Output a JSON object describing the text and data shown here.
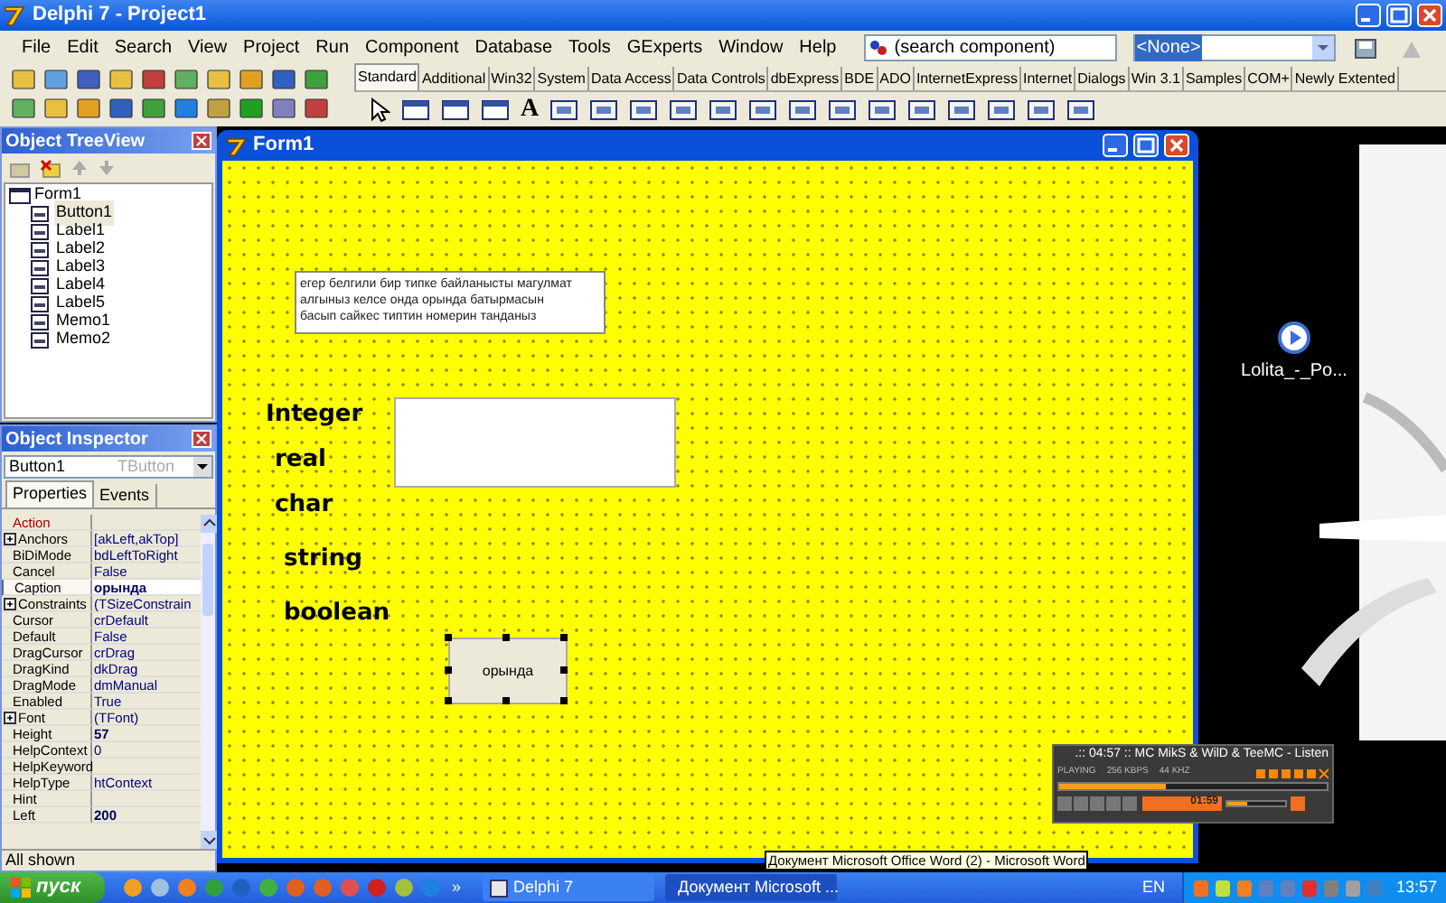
{
  "main_window": {
    "title": "Delphi 7 - Project1",
    "menu": [
      "File",
      "Edit",
      "Search",
      "View",
      "Project",
      "Run",
      "Component",
      "Database",
      "Tools",
      "GExperts",
      "Window",
      "Help"
    ],
    "component_search": {
      "value": "(search component)"
    },
    "desktop_combo": {
      "value": "<None>"
    },
    "palette_tabs": [
      {
        "label": "Standard",
        "selected": true
      },
      {
        "label": "Additional",
        "selected": false
      },
      {
        "label": "Win32",
        "selected": false
      },
      {
        "label": "System",
        "selected": false
      },
      {
        "label": "Data Access",
        "selected": false
      },
      {
        "label": "Data Controls",
        "selected": false
      },
      {
        "label": "dbExpress",
        "selected": false
      },
      {
        "label": "BDE",
        "selected": false
      },
      {
        "label": "ADO",
        "selected": false
      },
      {
        "label": "InternetExpress",
        "selected": false
      },
      {
        "label": "Internet",
        "selected": false
      },
      {
        "label": "Dialogs",
        "selected": false
      },
      {
        "label": "Win 3.1",
        "selected": false
      },
      {
        "label": "Samples",
        "selected": false
      },
      {
        "label": "COM+",
        "selected": false
      },
      {
        "label": "Newly Extented",
        "selected": false
      }
    ],
    "palette_label_glyph": "A"
  },
  "object_treeview": {
    "title": "Object TreeView",
    "root": {
      "label": "Form1",
      "children": [
        {
          "label": "Button1",
          "selected": true
        },
        {
          "label": "Label1",
          "selected": false
        },
        {
          "label": "Label2",
          "selected": false
        },
        {
          "label": "Label3",
          "selected": false
        },
        {
          "label": "Label4",
          "selected": false
        },
        {
          "label": "Label5",
          "selected": false
        },
        {
          "label": "Memo1",
          "selected": false
        },
        {
          "label": "Memo2",
          "selected": false
        }
      ]
    }
  },
  "object_inspector": {
    "title": "Object Inspector",
    "object": "Button1",
    "object_type": "TButton",
    "tabs": [
      {
        "label": "Properties",
        "selected": true
      },
      {
        "label": "Events",
        "selected": false
      }
    ],
    "properties": [
      {
        "name": "Action",
        "kind": "link",
        "modified": false,
        "selected": false
      },
      {
        "name": "Anchors",
        "value": "[akLeft,akTop]",
        "kind": "expandable",
        "modified": false,
        "selected": false
      },
      {
        "name": "BiDiMode",
        "value": "bdLeftToRight",
        "kind": "plain",
        "modified": false,
        "selected": false
      },
      {
        "name": "Cancel",
        "value": "False",
        "kind": "plain",
        "modified": false,
        "selected": false
      },
      {
        "name": "Caption",
        "value": "орында",
        "kind": "plain",
        "modified": true,
        "selected": true
      },
      {
        "name": "Constraints",
        "value": "(TSizeConstrain",
        "kind": "expandable",
        "modified": false,
        "selected": false
      },
      {
        "name": "Cursor",
        "value": "crDefault",
        "kind": "plain",
        "modified": false,
        "selected": false
      },
      {
        "name": "Default",
        "value": "False",
        "kind": "plain",
        "modified": false,
        "selected": false
      },
      {
        "name": "DragCursor",
        "value": "crDrag",
        "kind": "plain",
        "modified": false,
        "selected": false
      },
      {
        "name": "DragKind",
        "value": "dkDrag",
        "kind": "plain",
        "modified": false,
        "selected": false
      },
      {
        "name": "DragMode",
        "value": "dmManual",
        "kind": "plain",
        "modified": false,
        "selected": false
      },
      {
        "name": "Enabled",
        "value": "True",
        "kind": "plain",
        "modified": false,
        "selected": false
      },
      {
        "name": "Font",
        "value": "(TFont)",
        "kind": "expandable",
        "modified": false,
        "selected": false
      },
      {
        "name": "Height",
        "value": "57",
        "kind": "plain",
        "modified": true,
        "selected": false
      },
      {
        "name": "HelpContext",
        "value": "0",
        "kind": "plain",
        "modified": false,
        "selected": false
      },
      {
        "name": "HelpKeyword",
        "kind": "plain",
        "modified": false,
        "selected": false
      },
      {
        "name": "HelpType",
        "value": "htContext",
        "kind": "plain",
        "modified": false,
        "selected": false
      },
      {
        "name": "Hint",
        "kind": "plain",
        "modified": false,
        "selected": false
      },
      {
        "name": "Left",
        "value": "200",
        "kind": "plain",
        "modified": true,
        "selected": false
      }
    ],
    "status": "All shown"
  },
  "form": {
    "title": "Form1",
    "memo1": {
      "lines": [
        "егер белгили бир типке байланысты магулмат",
        "алгыныз келсе онда орында батырмасын",
        "басып сайкес типтин номерин танданыз"
      ]
    },
    "labels": [
      "Integer",
      "real",
      "char",
      "string",
      "boolean"
    ],
    "button": {
      "caption": "орында",
      "selected": true
    }
  },
  "desktop_icon": {
    "label": "Lolita_-_Po..."
  },
  "media_player": {
    "title": ".:: 04:57 :: MC MikS & WilD & TeeMC - Listen",
    "state": "PLAYING",
    "bitrate": "256 KBPS",
    "samplerate": "44 KHZ",
    "time": "01:59",
    "seek": {
      "level": 0.4
    },
    "volume": {
      "level": 0.35
    }
  },
  "tooltip": "Документ Microsoft Office Word (2) - Microsoft Word",
  "taskbar": {
    "start": "пуск",
    "more": "»",
    "tasks": [
      {
        "label": "Delphi 7",
        "selected": false
      },
      {
        "label": "Документ Microsoft ...",
        "selected": true
      }
    ],
    "language": "EN",
    "clock": "13:57"
  }
}
